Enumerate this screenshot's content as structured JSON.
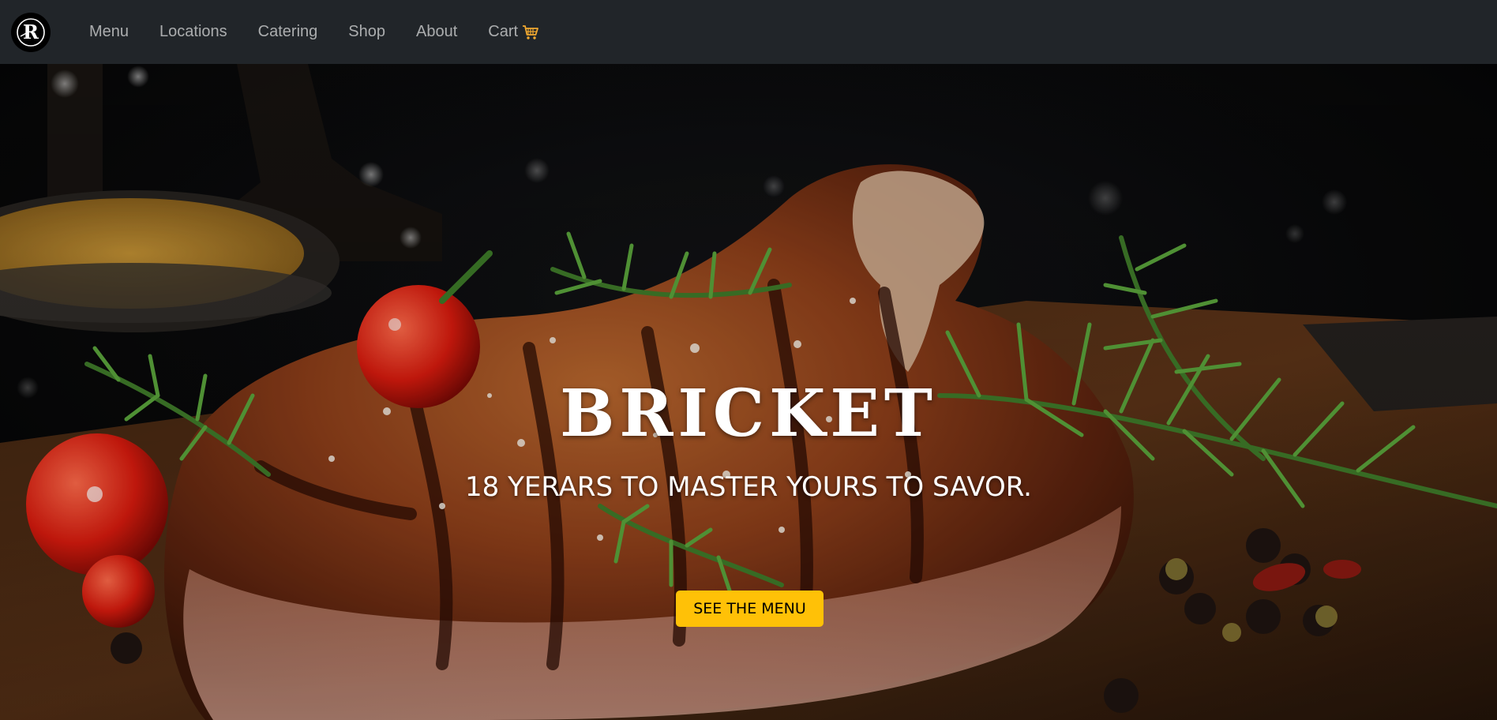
{
  "nav": {
    "logo_letter": "R",
    "items": [
      {
        "label": "Menu"
      },
      {
        "label": "Locations"
      },
      {
        "label": "Catering"
      },
      {
        "label": "Shop"
      },
      {
        "label": "About"
      },
      {
        "label": "Cart"
      }
    ],
    "cart_icon": "shopping-cart-icon"
  },
  "hero": {
    "title": "BRICKET",
    "subtitle": "18 YERARS TO MASTER YOURS TO SAVOR.",
    "cta_label": "SEE THE MENU"
  },
  "colors": {
    "navbar_bg": "#212529",
    "nav_text": "#9a9da0",
    "accent": "#ffc107",
    "cart_icon": "#f0a830"
  }
}
